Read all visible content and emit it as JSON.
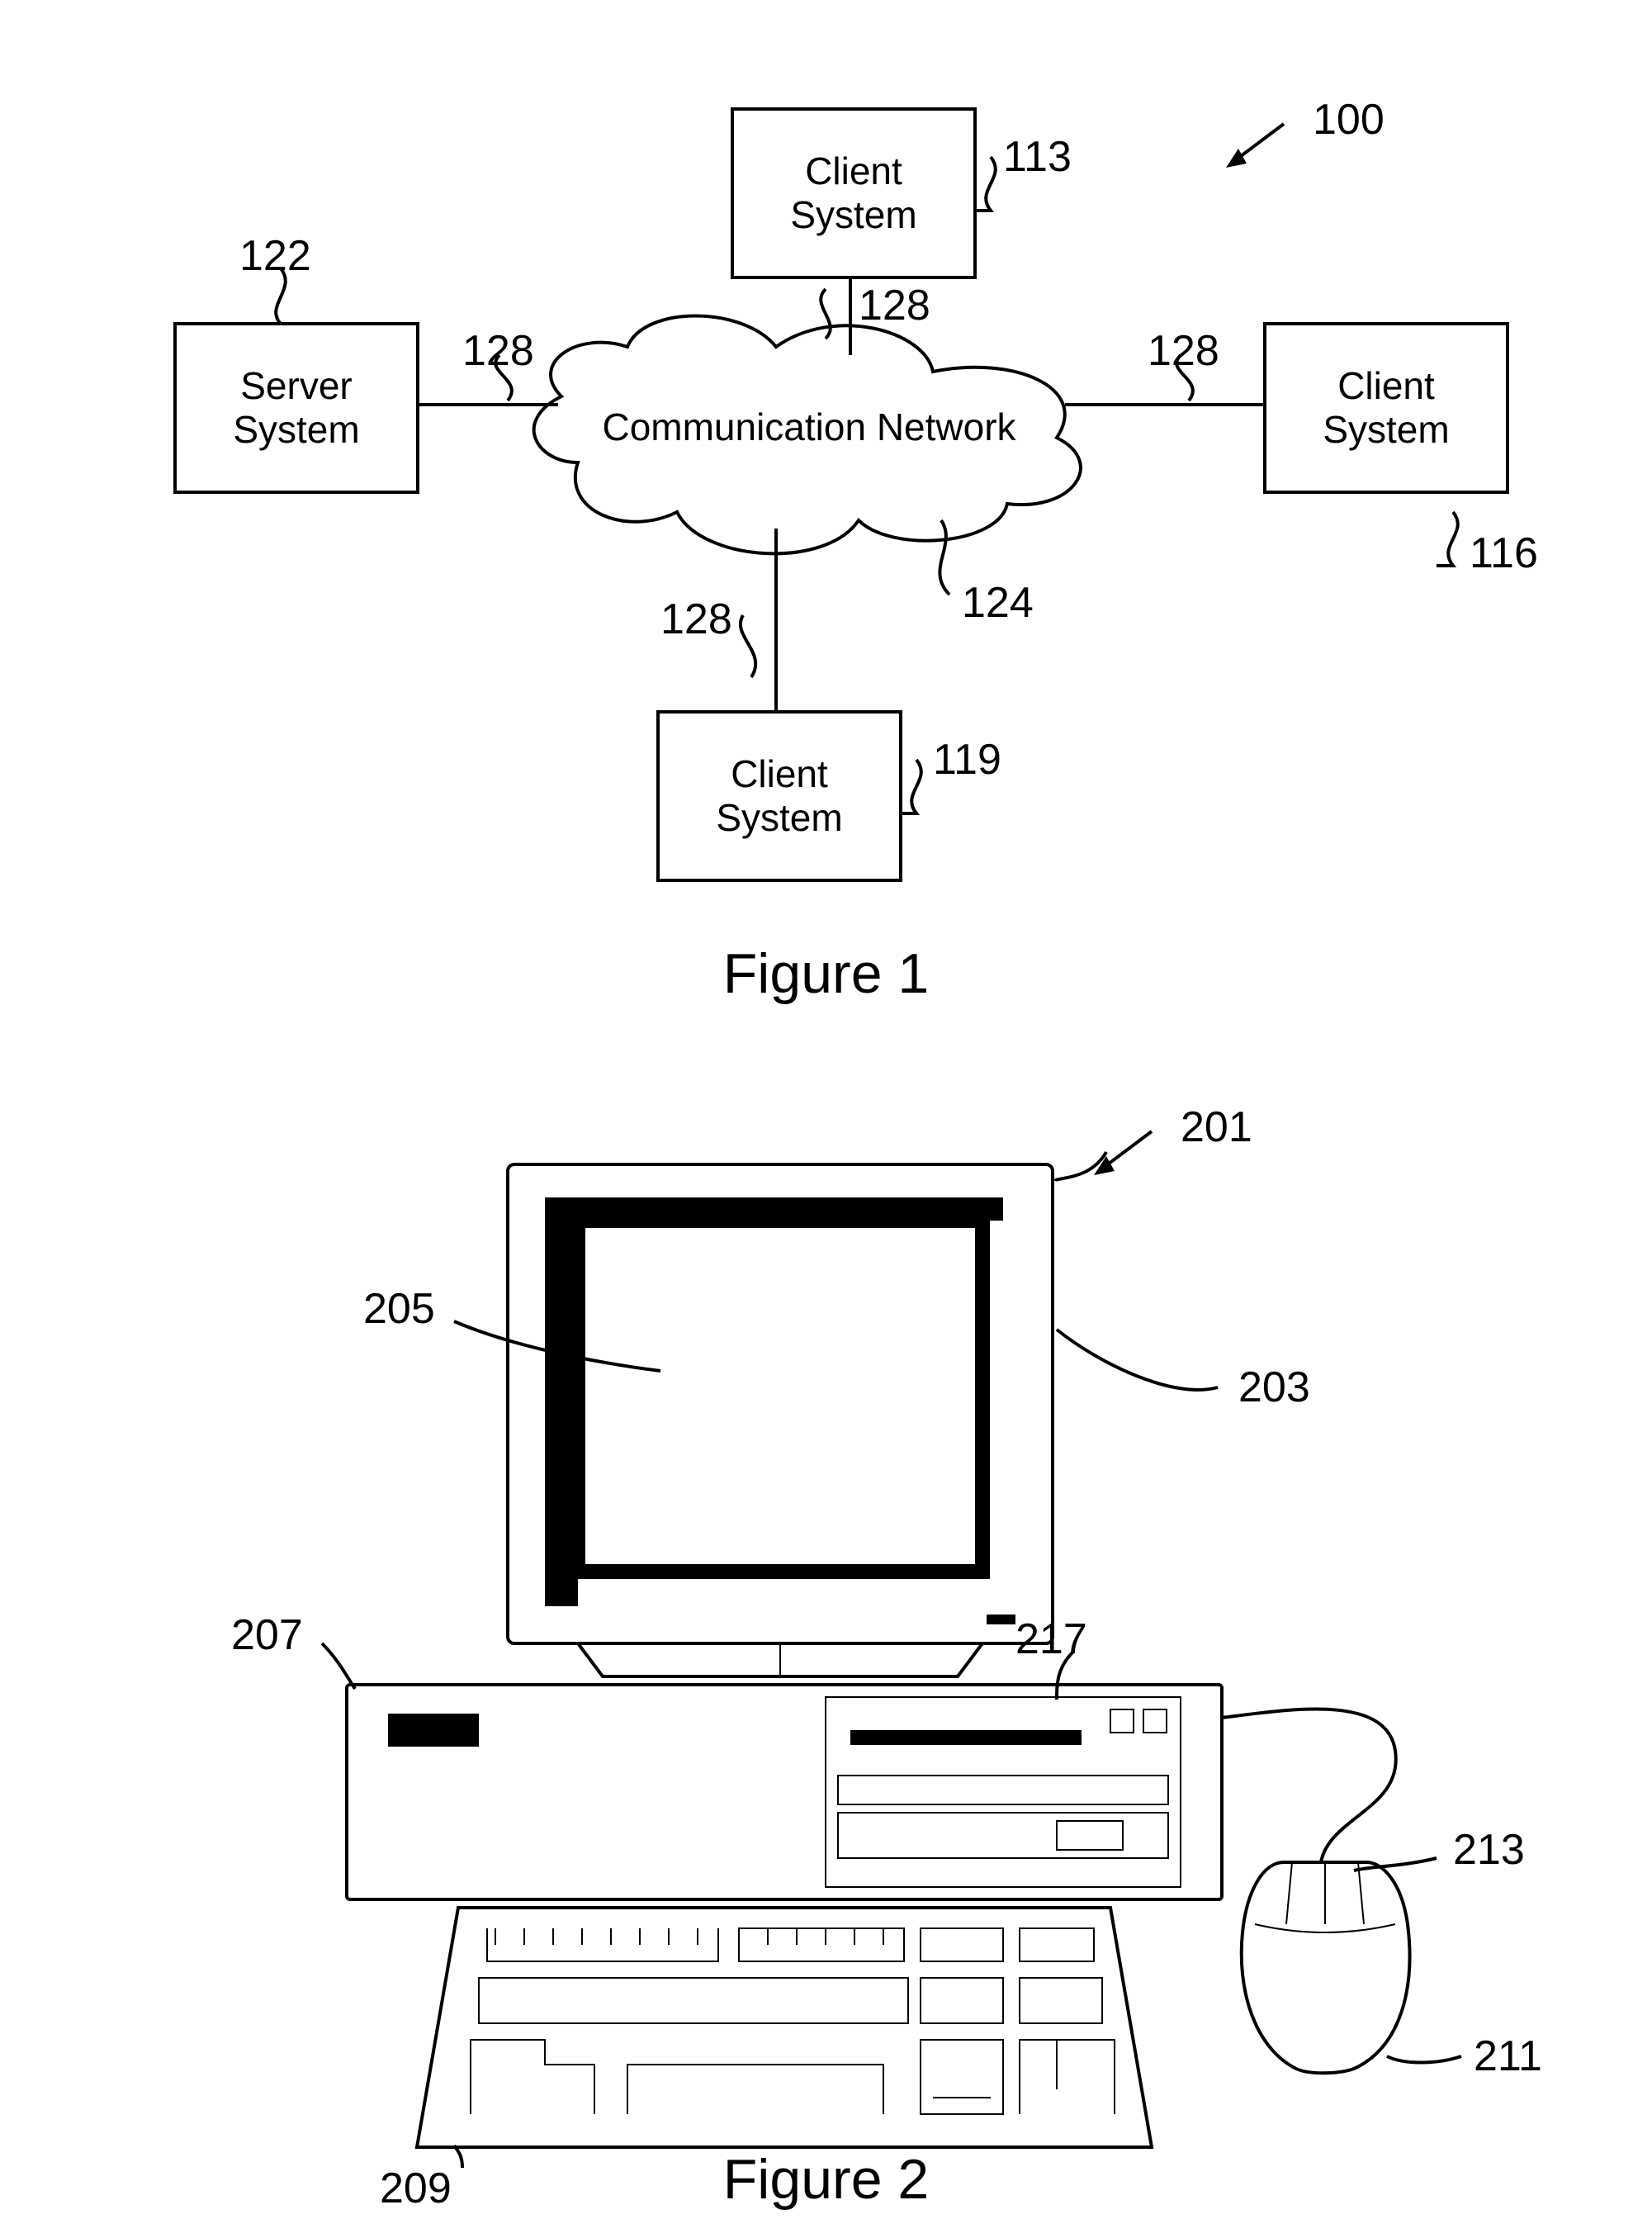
{
  "figure1": {
    "caption": "Figure 1",
    "ref_all": "100",
    "cloud_label": "Communication Network",
    "refs": {
      "server": "122",
      "client_top": "113",
      "client_right": "116",
      "client_bottom": "119",
      "cloud": "124",
      "link_top": "128",
      "link_left": "128",
      "link_right": "128",
      "link_bottom": "128"
    },
    "boxes": {
      "server_l1": "Server",
      "server_l2": "System",
      "client_l1": "Client",
      "client_l2": "System"
    }
  },
  "figure2": {
    "caption": "Figure 2",
    "refs": {
      "all": "201",
      "monitor": "203",
      "screen": "205",
      "tower": "207",
      "keyboard": "209",
      "mouse": "211",
      "mouse_buttons": "213",
      "drive": "217"
    }
  }
}
